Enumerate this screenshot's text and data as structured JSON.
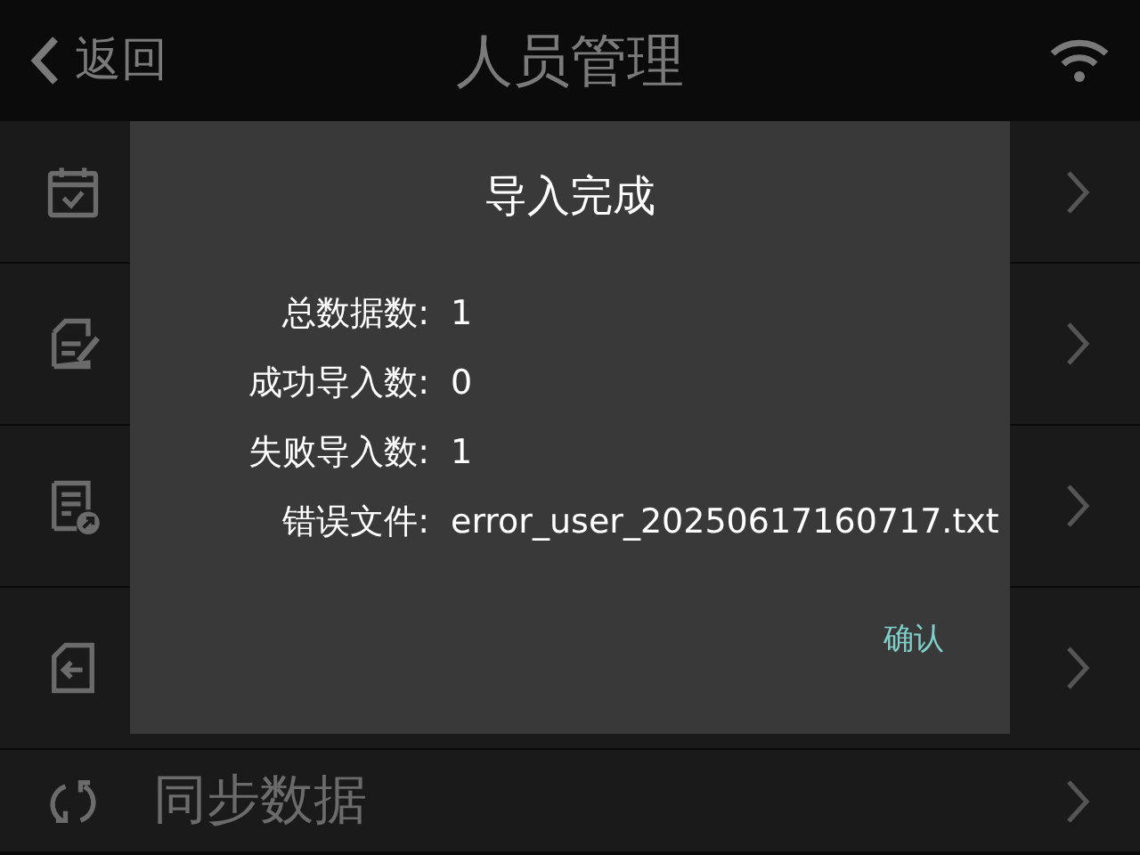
{
  "header": {
    "back_label": "返回",
    "title": "人员管理"
  },
  "menu_items": [
    {
      "kind": "calendar"
    },
    {
      "kind": "form"
    },
    {
      "kind": "export"
    },
    {
      "kind": "import"
    },
    {
      "kind": "sync",
      "label": "同步数据"
    }
  ],
  "dialog": {
    "title": "导入完成",
    "fields": [
      {
        "label": "总数据数:",
        "value": "1"
      },
      {
        "label": "成功导入数:",
        "value": "0"
      },
      {
        "label": "失败导入数:",
        "value": "1"
      },
      {
        "label": "错误文件:",
        "value": "error_user_20250617160717.txt"
      }
    ],
    "confirm_button": "确认"
  }
}
